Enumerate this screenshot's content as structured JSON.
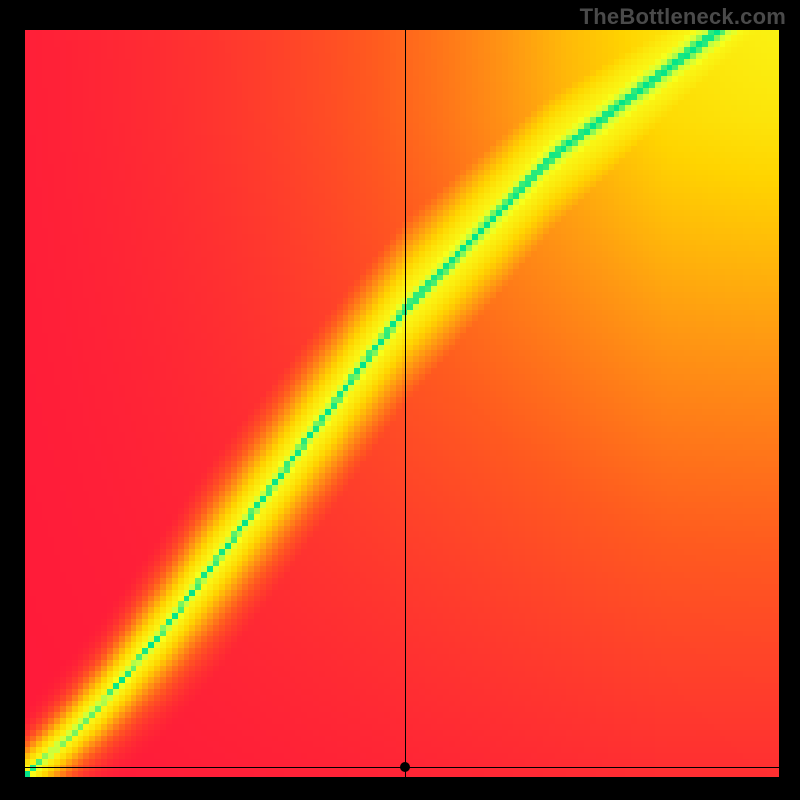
{
  "watermark": "TheBottleneck.com",
  "chart_data": {
    "type": "heatmap",
    "title": "",
    "xlabel": "",
    "ylabel": "",
    "x_range": [
      0,
      1
    ],
    "y_range": [
      0,
      1
    ],
    "resolution": 128,
    "colorscale": [
      {
        "stop": 0.0,
        "color": "#ff1a3a"
      },
      {
        "stop": 0.25,
        "color": "#ff5a1f"
      },
      {
        "stop": 0.45,
        "color": "#ff9a12"
      },
      {
        "stop": 0.62,
        "color": "#ffd400"
      },
      {
        "stop": 0.8,
        "color": "#f8ff1a"
      },
      {
        "stop": 0.95,
        "color": "#c8ff40"
      },
      {
        "stop": 1.0,
        "color": "#00e58a"
      }
    ],
    "ridge_function": {
      "comment": "y_center ≈ f(x): piecewise curve. Near-diagonal for x<0.18, then slope increases.",
      "knots_x": [
        0.0,
        0.05,
        0.1,
        0.18,
        0.3,
        0.5,
        0.7,
        0.85,
        1.0
      ],
      "knots_y": [
        0.0,
        0.045,
        0.095,
        0.19,
        0.35,
        0.62,
        0.83,
        0.945,
        1.06
      ]
    },
    "ridge_width_x": {
      "comment": "Half-width of optimal band along x, as fraction of domain",
      "knots_x": [
        0.0,
        0.1,
        0.25,
        0.5,
        0.75,
        1.0
      ],
      "knots_w": [
        0.01,
        0.014,
        0.022,
        0.028,
        0.033,
        0.04
      ]
    },
    "background_gradient": {
      "comment": "Underlying glow field: center-ish warm falloff biased to upper-right",
      "cx": 1.05,
      "cy": 1.05,
      "radius": 1.55,
      "inner_value": 0.78,
      "outer_value": 0.0,
      "left_wall_pull": 0.85
    },
    "crosshair": {
      "x": 0.504,
      "y": 0.013
    },
    "marker": {
      "x": 0.504,
      "y": 0.013
    }
  }
}
